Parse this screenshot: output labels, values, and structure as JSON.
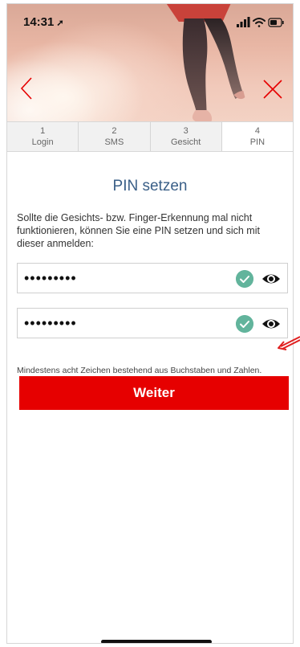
{
  "status_bar": {
    "time": "14:31",
    "location_arrow": "➚"
  },
  "steps": [
    {
      "number": "1",
      "label": "Login"
    },
    {
      "number": "2",
      "label": "SMS"
    },
    {
      "number": "3",
      "label": "Gesicht"
    },
    {
      "number": "4",
      "label": "PIN"
    }
  ],
  "active_step": 4,
  "title": "PIN setzen",
  "intro": "Sollte die Gesichts- bzw. Finger-Erkennung mal nicht funktionieren, können Sie eine PIN setzen und sich mit dieser anmelden:",
  "pin_field": {
    "value": "•••••••••"
  },
  "pin_confirm_field": {
    "value": "•••••••••"
  },
  "hint": "Mindestens acht Zeichen bestehend aus Buchstaben und Zahlen.",
  "next_button": {
    "label": "Weiter"
  },
  "icons": {
    "back": "chevron-left-icon",
    "close": "close-icon",
    "valid": "check-icon",
    "reveal": "eye-icon"
  },
  "colors": {
    "accent_red": "#e60000",
    "title_blue": "#3a5f87",
    "check_green": "#62b49c"
  }
}
